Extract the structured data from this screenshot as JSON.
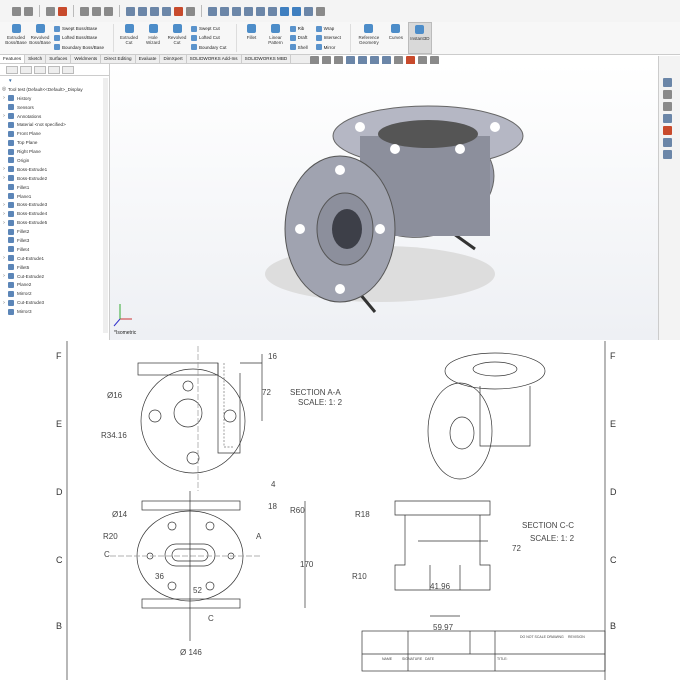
{
  "toolbar": {
    "features": [
      {
        "label": "Extruded Boss/Base"
      },
      {
        "label": "Revolved Boss/Base"
      }
    ],
    "boss_stack": [
      "Swept Boss/Base",
      "Lofted Boss/Base",
      "Boundary Boss/Base"
    ],
    "cut_cmds": [
      {
        "label": "Extruded Cut"
      },
      {
        "label": "Hole Wizard"
      },
      {
        "label": "Revolved Cut"
      }
    ],
    "cut_stack": [
      "Swept Cut",
      "Lofted Cut",
      "Boundary Cut"
    ],
    "mod_cmds": [
      {
        "label": "Fillet"
      },
      {
        "label": "Linear Pattern"
      }
    ],
    "mod_stack": [
      "Rib",
      "Draft",
      "Shell"
    ],
    "mod_stack2": [
      "Wrap",
      "Intersect",
      "Mirror"
    ],
    "ref_cmds": [
      {
        "label": "Reference Geometry"
      },
      {
        "label": "Curves"
      },
      {
        "label": "Instant3D"
      }
    ]
  },
  "tabs": [
    "Features",
    "Sketch",
    "Surfaces",
    "Weldments",
    "Direct Editing",
    "Evaluate",
    "DimXpert",
    "SOLIDWORKS Add-Ins",
    "SOLIDWORKS MBD"
  ],
  "tree": {
    "root": "Tool test (Default<<Default>_Display",
    "items": [
      {
        "label": "History",
        "ex": true
      },
      {
        "label": "Sensors",
        "ex": false
      },
      {
        "label": "Annotations",
        "ex": true
      },
      {
        "label": "Material <not specified>",
        "ex": false
      },
      {
        "label": "Front Plane",
        "ex": false
      },
      {
        "label": "Top Plane",
        "ex": false
      },
      {
        "label": "Right Plane",
        "ex": false
      },
      {
        "label": "Origin",
        "ex": false
      },
      {
        "label": "Boss-Extrude1",
        "ex": true
      },
      {
        "label": "Boss-Extrude2",
        "ex": true
      },
      {
        "label": "Fillet1",
        "ex": false
      },
      {
        "label": "Plane1",
        "ex": false
      },
      {
        "label": "Boss-Extrude3",
        "ex": true
      },
      {
        "label": "Boss-Extrude4",
        "ex": true
      },
      {
        "label": "Boss-Extrude5",
        "ex": true
      },
      {
        "label": "Fillet2",
        "ex": false
      },
      {
        "label": "Fillet3",
        "ex": false
      },
      {
        "label": "Fillet4",
        "ex": false
      },
      {
        "label": "Cut-Extrude1",
        "ex": true
      },
      {
        "label": "Fillet5",
        "ex": false
      },
      {
        "label": "Cut-Extrude2",
        "ex": true
      },
      {
        "label": "Plane2",
        "ex": false
      },
      {
        "label": "Mirror2",
        "ex": false
      },
      {
        "label": "Cut-Extrude3",
        "ex": true
      },
      {
        "label": "Mirror3",
        "ex": false
      }
    ]
  },
  "viewport": {
    "view_label": "*Isometric"
  },
  "drawing": {
    "zones": [
      "F",
      "E",
      "D",
      "C",
      "B"
    ],
    "section_aa": {
      "title": "SECTION A-A",
      "scale": "SCALE: 1: 2"
    },
    "section_cc": {
      "title": "SECTION C-C",
      "scale": "SCALE: 1: 2"
    },
    "dims": {
      "d16": "16",
      "d72": "72",
      "dia16": "Ø16",
      "r3416": "R34.16",
      "d4": "4",
      "d18": "18",
      "r60": "R60",
      "dia14": "Ø14",
      "r20": "R20",
      "d36": "36",
      "d52": "52",
      "d170": "170",
      "dia146": "Ø 146",
      "r18": "R18",
      "r10": "R10",
      "d72b": "72",
      "d4196": "41.96",
      "d5997": "59.97",
      "c": "C",
      "a": "A"
    },
    "title_block": {
      "title": "DO NOT SCALE DRAWING",
      "revision": "REVISION",
      "name": "NAME",
      "signature": "SIGNATURE",
      "date": "DATE",
      "title_label": "TITLE:"
    }
  },
  "colors": {
    "accent": "#4d8dc9",
    "model": "#8c8f9c"
  }
}
